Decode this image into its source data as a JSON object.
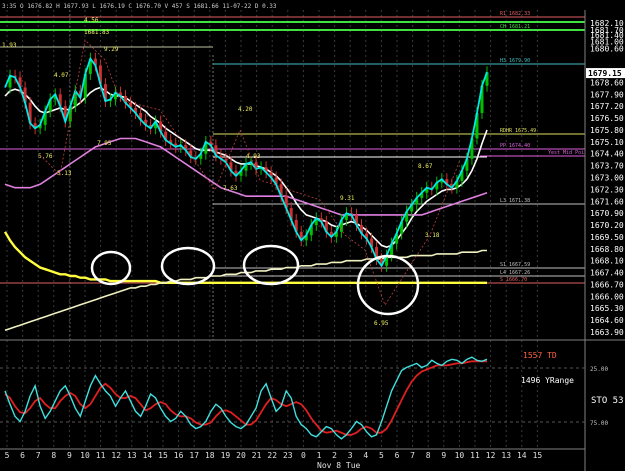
{
  "header_text": "3:35  O 1676.82  H 1677.93  L 1676.19  C 1676.70  V 457  S 1681.66  11-07-22  D 0.33",
  "price_axis": {
    "labels": [
      "1682.10",
      "1681.70",
      "1681.40",
      "1681.00",
      "1680.60",
      "1679.15",
      "1678.60",
      "1677.90",
      "1677.20",
      "1676.50",
      "1675.80",
      "1675.10",
      "1674.40",
      "1673.70",
      "1673.00",
      "1672.30",
      "1671.60",
      "1670.90",
      "1670.20",
      "1669.50",
      "1668.80",
      "1668.10",
      "1667.40",
      "1666.70",
      "1666.00",
      "1665.30",
      "1664.60",
      "1663.90"
    ],
    "last_price": "1679.15",
    "last_price_bg": "#ffffff"
  },
  "time_axis": {
    "labels": [
      "5",
      "6",
      "7",
      "8",
      "9",
      "10",
      "11",
      "12",
      "13",
      "14",
      "15",
      "16",
      "17",
      "18",
      "19",
      "20",
      "21",
      "22",
      "23",
      "0",
      "1",
      "2",
      "3",
      "4",
      "5",
      "6",
      "7",
      "8",
      "9",
      "10",
      "11",
      "12",
      "13",
      "14",
      "15"
    ],
    "date_label": "Nov 8 Tue"
  },
  "levels": [
    {
      "label": "R1  1682.33",
      "color": "#e06060"
    },
    {
      "label": "CH  1681.21",
      "color": "#40e040"
    },
    {
      "label": "H3  1679.90",
      "color": "#40c0c0"
    },
    {
      "label": "RDHR  1675.49",
      "color": "#e0e060"
    },
    {
      "label": "PP  1674.40",
      "color": "#e060e0"
    },
    {
      "label": "Yest Mid Poi",
      "color": "#e060e0"
    },
    {
      "label": "L3  1671.38",
      "color": "#c0c0c0"
    },
    {
      "label": "S1  1667.59",
      "color": "#c0c0c0"
    },
    {
      "label": "L4  1667.26",
      "color": "#c0c0c0"
    },
    {
      "label": "S  1666.70",
      "color": "#e06060"
    }
  ],
  "swing_labels": [
    "4.56",
    "1681.83",
    "9.29",
    "4.07",
    "5.76",
    "5.13",
    "7.95",
    "4.20",
    "7.63",
    "9.31",
    "8.67",
    "3.18",
    "6.95",
    "4.93",
    "1.93"
  ],
  "indicator": {
    "td_label": "1557 TD",
    "yrange_label": "1496 YRange",
    "sto_label": "STO  53",
    "level_labels": [
      "25.00",
      "75.00"
    ]
  },
  "colors": {
    "price_line": "#00e8e8",
    "candle_up": "#00c000",
    "candle_down": "#d03030",
    "ma_white": "#ffffff",
    "ma_pink": "#e080e0",
    "ma_yellow": "#ffff40",
    "osc_fast": "#40e0e0",
    "osc_slow": "#e02020",
    "td_color": "#ff6040",
    "circle": "#ffffff"
  },
  "chart_data": {
    "type": "line",
    "x_unit": "bar index (30-min bars)",
    "series": [
      {
        "values": [
          1678.3,
          1679.0,
          1678.9,
          1678.3,
          1677.4,
          1676.2,
          1675.9,
          1676.1,
          1676.9,
          1677.6,
          1677.9,
          1677.2,
          1676.3,
          1677.2,
          1678.1,
          1677.7,
          1679.1,
          1680.0,
          1679.6,
          1678.5,
          1677.5,
          1677.6,
          1678.0,
          1677.8,
          1677.4,
          1677.1,
          1676.8,
          1676.4,
          1676.1,
          1675.9,
          1676.3,
          1675.7,
          1675.2,
          1675.0,
          1674.8,
          1674.9,
          1674.6,
          1674.2,
          1674.1,
          1674.4,
          1675.1,
          1674.9,
          1674.3,
          1674.1,
          1673.9,
          1673.4,
          1673.1,
          1673.4,
          1673.8,
          1673.9,
          1673.5,
          1673.6,
          1673.3,
          1673.0,
          1672.6,
          1671.9,
          1671.2,
          1670.5,
          1669.8,
          1669.3,
          1669.6,
          1670.2,
          1670.6,
          1670.4,
          1669.8,
          1669.5,
          1669.8,
          1670.5,
          1670.9,
          1670.8,
          1670.2,
          1669.7,
          1669.4,
          1668.9,
          1668.2,
          1667.8,
          1668.4,
          1669.1,
          1669.7,
          1670.4,
          1671.0,
          1671.4,
          1671.8,
          1672.1,
          1672.4,
          1672.3,
          1672.7,
          1672.9,
          1672.6,
          1672.4,
          1672.8,
          1673.4,
          1674.1,
          1675.3,
          1676.8,
          1678.4,
          1679.2
        ]
      },
      {
        "values": [
          1677.8,
          1678.1,
          1678.2,
          1678.1,
          1677.9,
          1677.6,
          1677.2,
          1676.9,
          1676.8,
          1676.9,
          1677.0,
          1677.1,
          1677.0,
          1677.0,
          1677.2,
          1677.4,
          1677.7,
          1678.0,
          1678.2,
          1678.3,
          1678.1,
          1677.9,
          1677.8,
          1677.8,
          1677.7,
          1677.5,
          1677.3,
          1677.1,
          1676.9,
          1676.6,
          1676.4,
          1676.2,
          1675.9,
          1675.7,
          1675.5,
          1675.3,
          1675.1,
          1674.9,
          1674.7,
          1674.6,
          1674.6,
          1674.6,
          1674.5,
          1674.4,
          1674.3,
          1674.1,
          1673.9,
          1673.8,
          1673.8,
          1673.8,
          1673.7,
          1673.6,
          1673.5,
          1673.3,
          1673.1,
          1672.8,
          1672.4,
          1672.0,
          1671.5,
          1671.1,
          1670.8,
          1670.7,
          1670.6,
          1670.5,
          1670.4,
          1670.2,
          1670.1,
          1670.2,
          1670.3,
          1670.4,
          1670.3,
          1670.1,
          1669.9,
          1669.6,
          1669.3,
          1669.0,
          1668.9,
          1669.0,
          1669.3,
          1669.7,
          1670.1,
          1670.6,
          1671.0,
          1671.3,
          1671.6,
          1671.8,
          1672.0,
          1672.2,
          1672.3,
          1672.3,
          1672.4,
          1672.6,
          1672.9,
          1673.4,
          1674.1,
          1675.0,
          1675.8
        ]
      },
      {
        "values": [
          1672.6,
          1672.5,
          1672.4,
          1672.4,
          1672.4,
          1672.4,
          1672.5,
          1672.6,
          1672.8,
          1673.0,
          1673.2,
          1673.4,
          1673.6,
          1673.8,
          1674.0,
          1674.2,
          1674.4,
          1674.6,
          1674.8,
          1674.9,
          1675.0,
          1675.1,
          1675.2,
          1675.3,
          1675.3,
          1675.3,
          1675.3,
          1675.2,
          1675.1,
          1675.0,
          1674.9,
          1674.8,
          1674.6,
          1674.4,
          1674.2,
          1674.0,
          1673.8,
          1673.6,
          1673.4,
          1673.2,
          1673.0,
          1672.8,
          1672.6,
          1672.4,
          1672.3,
          1672.2,
          1672.1,
          1672.0,
          1671.9,
          1671.9,
          1671.9,
          1671.9,
          1671.9,
          1671.9,
          1671.9,
          1671.9,
          1671.9,
          1671.8,
          1671.7,
          1671.6,
          1671.5,
          1671.4,
          1671.3,
          1671.2,
          1671.1,
          1671.0,
          1670.9,
          1670.8,
          1670.8,
          1670.8,
          1670.8,
          1670.8,
          1670.8,
          1670.8,
          1670.8,
          1670.8,
          1670.8,
          1670.8,
          1670.8,
          1670.8,
          1670.8,
          1670.8,
          1670.8,
          1670.8,
          1670.9,
          1671.0,
          1671.1,
          1671.2,
          1671.3,
          1671.4,
          1671.5,
          1671.6,
          1671.7,
          1671.8,
          1671.9,
          1672.0,
          1672.1
        ]
      },
      {
        "values": [
          1669.8,
          1669.3,
          1668.9,
          1668.6,
          1668.3,
          1668.1,
          1667.9,
          1667.7,
          1667.6,
          1667.5,
          1667.4,
          1667.3,
          1667.3,
          1667.2,
          1667.2,
          1667.1,
          1667.1,
          1667.0,
          1667.0,
          1667.0,
          1667.0,
          1666.9,
          1666.9,
          1666.9,
          1666.9,
          1666.9,
          1666.9,
          1666.9,
          1666.9,
          1666.9,
          1666.9,
          1666.8,
          1666.8,
          1666.8,
          1666.8,
          1666.8,
          1666.8,
          1666.8,
          1666.8,
          1666.8,
          1666.8,
          1666.8,
          1666.8,
          1666.8,
          1666.8,
          1666.8,
          1666.8,
          1666.8,
          1666.8,
          1666.8,
          1666.8,
          1666.8,
          1666.8,
          1666.8,
          1666.8,
          1666.8,
          1666.8,
          1666.8,
          1666.8,
          1666.8,
          1666.8,
          1666.8,
          1666.8,
          1666.8,
          1666.8,
          1666.8,
          1666.8,
          1666.8,
          1666.8,
          1666.8,
          1666.8,
          1666.8,
          1666.8,
          1666.8,
          1666.8,
          1666.8,
          1666.8,
          1666.8,
          1666.8,
          1666.8,
          1666.8,
          1666.8,
          1666.8,
          1666.8,
          1666.8,
          1666.8,
          1666.8,
          1666.8,
          1666.8,
          1666.8,
          1666.8,
          1666.8,
          1666.8,
          1666.8,
          1666.8,
          1666.8,
          1666.8
        ]
      },
      {
        "values": [
          1664.0,
          1664.1,
          1664.2,
          1664.3,
          1664.4,
          1664.5,
          1664.6,
          1664.7,
          1664.8,
          1664.9,
          1665.0,
          1665.1,
          1665.2,
          1665.3,
          1665.4,
          1665.5,
          1665.6,
          1665.7,
          1665.8,
          1665.9,
          1666.0,
          1666.1,
          1666.2,
          1666.3,
          1666.4,
          1666.5,
          1666.5,
          1666.6,
          1666.6,
          1666.7,
          1666.7,
          1666.8,
          1666.8,
          1666.9,
          1666.9,
          1667.0,
          1667.0,
          1667.0,
          1667.1,
          1667.1,
          1667.1,
          1667.2,
          1667.2,
          1667.2,
          1667.3,
          1667.3,
          1667.3,
          1667.4,
          1667.4,
          1667.4,
          1667.5,
          1667.5,
          1667.5,
          1667.6,
          1667.6,
          1667.6,
          1667.7,
          1667.7,
          1667.7,
          1667.8,
          1667.8,
          1667.8,
          1667.9,
          1667.9,
          1667.9,
          1668.0,
          1668.0,
          1668.0,
          1668.1,
          1668.1,
          1668.1,
          1668.1,
          1668.2,
          1668.2,
          1668.2,
          1668.2,
          1668.3,
          1668.3,
          1668.3,
          1668.3,
          1668.3,
          1668.4,
          1668.4,
          1668.4,
          1668.4,
          1668.4,
          1668.5,
          1668.5,
          1668.5,
          1668.5,
          1668.5,
          1668.6,
          1668.6,
          1668.6,
          1668.6,
          1668.7,
          1668.7
        ]
      }
    ],
    "oscillator": {
      "fast": [
        55,
        42,
        30,
        25,
        35,
        50,
        60,
        40,
        28,
        35,
        45,
        55,
        60,
        50,
        38,
        30,
        45,
        60,
        70,
        62,
        55,
        50,
        40,
        48,
        55,
        45,
        35,
        30,
        40,
        52,
        48,
        38,
        30,
        25,
        28,
        35,
        30,
        22,
        18,
        20,
        25,
        35,
        42,
        38,
        30,
        24,
        20,
        18,
        22,
        30,
        38,
        55,
        62,
        48,
        35,
        40,
        55,
        48,
        30,
        22,
        18,
        12,
        10,
        15,
        20,
        18,
        12,
        8,
        12,
        18,
        25,
        22,
        15,
        10,
        12,
        25,
        40,
        55,
        65,
        75,
        78,
        80,
        82,
        78,
        80,
        85,
        82,
        80,
        84,
        86,
        85,
        82,
        86,
        88,
        85,
        84,
        86
      ],
      "slow": [
        52,
        48,
        40,
        34,
        33,
        38,
        45,
        48,
        42,
        38,
        38,
        45,
        50,
        53,
        50,
        42,
        38,
        42,
        50,
        58,
        62,
        58,
        52,
        48,
        48,
        50,
        48,
        42,
        36,
        38,
        42,
        44,
        42,
        36,
        32,
        30,
        30,
        28,
        24,
        22,
        22,
        24,
        30,
        35,
        36,
        34,
        30,
        26,
        22,
        22,
        26,
        34,
        42,
        48,
        46,
        42,
        40,
        42,
        44,
        42,
        36,
        28,
        22,
        16,
        14,
        15,
        16,
        14,
        12,
        12,
        14,
        18,
        20,
        18,
        14,
        14,
        18,
        26,
        36,
        46,
        56,
        64,
        70,
        74,
        76,
        78,
        80,
        80,
        80,
        81,
        82,
        82,
        83,
        84,
        84,
        84,
        84
      ]
    },
    "ylim": [
      1663.9,
      1682.1
    ],
    "osc_ylim": [
      0,
      100
    ]
  }
}
